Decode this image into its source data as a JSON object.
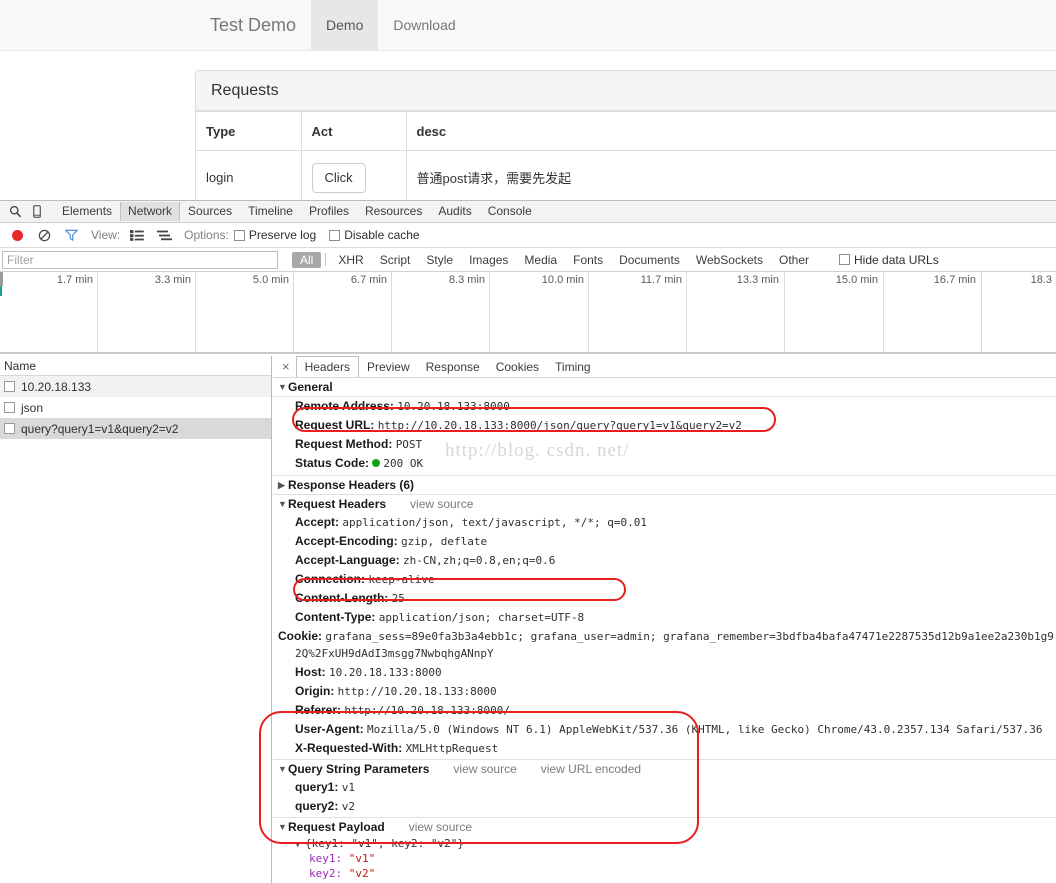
{
  "webpage": {
    "nav": {
      "brand": "Test Demo",
      "tabs": [
        {
          "label": "Demo",
          "active": true
        },
        {
          "label": "Download",
          "active": false
        }
      ]
    },
    "panel": {
      "title": "Requests",
      "columns": [
        "Type",
        "Act",
        "desc"
      ],
      "rows": [
        {
          "type": "login",
          "act": "Click",
          "desc": "普通post请求，需要先发起"
        }
      ]
    }
  },
  "devtools": {
    "panel_tabs": [
      {
        "label": "Elements",
        "selected": false
      },
      {
        "label": "Network",
        "selected": true
      },
      {
        "label": "Sources",
        "selected": false
      },
      {
        "label": "Timeline",
        "selected": false
      },
      {
        "label": "Profiles",
        "selected": false
      },
      {
        "label": "Resources",
        "selected": false
      },
      {
        "label": "Audits",
        "selected": false
      },
      {
        "label": "Console",
        "selected": false
      }
    ],
    "icons": {
      "inspect": "search-icon",
      "device": "device-toggle-icon",
      "record": "record-icon",
      "clear": "clear-icon",
      "filter": "filter-funnel-icon"
    },
    "toolbar": {
      "view_label": "View:",
      "options_label": "Options:",
      "preserve_log": "Preserve log",
      "disable_cache": "Disable cache",
      "preserve_log_checked": false,
      "disable_cache_checked": false
    },
    "filter": {
      "placeholder": "Filter",
      "value": "",
      "types": [
        "All",
        "XHR",
        "Script",
        "Style",
        "Images",
        "Media",
        "Fonts",
        "Documents",
        "WebSockets",
        "Other"
      ],
      "selected_type": "All",
      "hide_data_urls_label": "Hide data URLs",
      "hide_data_urls_checked": false
    },
    "timeline": {
      "ticks": [
        "1.7 min",
        "3.3 min",
        "5.0 min",
        "6.7 min",
        "8.3 min",
        "10.0 min",
        "11.7 min",
        "13.3 min",
        "15.0 min",
        "16.7 min",
        "18.3"
      ]
    },
    "requests": {
      "header": "Name",
      "items": [
        {
          "name": "10.20.18.133",
          "selected": false
        },
        {
          "name": "json",
          "selected": false
        },
        {
          "name": "query?query1=v1&query2=v2",
          "selected": true
        }
      ]
    },
    "detail": {
      "close": "×",
      "tabs": [
        {
          "label": "Headers",
          "selected": true
        },
        {
          "label": "Preview",
          "selected": false
        },
        {
          "label": "Response",
          "selected": false
        },
        {
          "label": "Cookies",
          "selected": false
        },
        {
          "label": "Timing",
          "selected": false
        }
      ],
      "general": {
        "title": "General",
        "remote_address_name": "Remote Address:",
        "remote_address_value": "10.20.18.133:8000",
        "request_url_name": "Request URL:",
        "request_url_value": "http://10.20.18.133:8000/json/query?query1=v1&query2=v2",
        "request_method_name": "Request Method:",
        "request_method_value": "POST",
        "status_code_name": "Status Code:",
        "status_code_value": "200 OK"
      },
      "response_headers": {
        "title": "Response Headers (6)"
      },
      "request_headers": {
        "title": "Request Headers",
        "view_source": "view source",
        "items": [
          {
            "name": "Accept:",
            "value": "application/json, text/javascript, */*; q=0.01"
          },
          {
            "name": "Accept-Encoding:",
            "value": "gzip, deflate"
          },
          {
            "name": "Accept-Language:",
            "value": "zh-CN,zh;q=0.8,en;q=0.6"
          },
          {
            "name": "Connection:",
            "value": "keep-alive"
          },
          {
            "name": "Content-Length:",
            "value": "25"
          },
          {
            "name": "Content-Type:",
            "value": "application/json; charset=UTF-8"
          },
          {
            "name": "Cookie:",
            "value": "grafana_sess=89e0fa3b3a4ebb1c; grafana_user=admin; grafana_remember=3bdfba4bafa47471e2287535d12b9a1ee2a230b1g92Q%2FxUH9dAdI3msgg7NwbqhgANnpY"
          },
          {
            "name": "Host:",
            "value": "10.20.18.133:8000"
          },
          {
            "name": "Origin:",
            "value": "http://10.20.18.133:8000"
          },
          {
            "name": "Referer:",
            "value": "http://10.20.18.133:8000/"
          },
          {
            "name": "User-Agent:",
            "value": "Mozilla/5.0 (Windows NT 6.1) AppleWebKit/537.36 (KHTML, like Gecko) Chrome/43.0.2357.134 Safari/537.36"
          },
          {
            "name": "X-Requested-With:",
            "value": "XMLHttpRequest"
          }
        ]
      },
      "query_string": {
        "title": "Query String Parameters",
        "view_source": "view source",
        "view_url_encoded": "view URL encoded",
        "items": [
          {
            "name": "query1:",
            "value": "v1"
          },
          {
            "name": "query2:",
            "value": "v2"
          }
        ]
      },
      "request_payload": {
        "title": "Request Payload",
        "view_source": "view source",
        "summary": "{key1: \"v1\", key2: \"v2\"}",
        "items": [
          {
            "key": "key1:",
            "value": "\"v1\""
          },
          {
            "key": "key2:",
            "value": "\"v2\""
          }
        ]
      }
    }
  },
  "watermark": "http://blog. csdn. net/",
  "colors": {
    "accent_red": "#e81f1f",
    "status_green": "#12a312",
    "record_red": "#e8282a",
    "filter_blue": "#4a90d9"
  }
}
